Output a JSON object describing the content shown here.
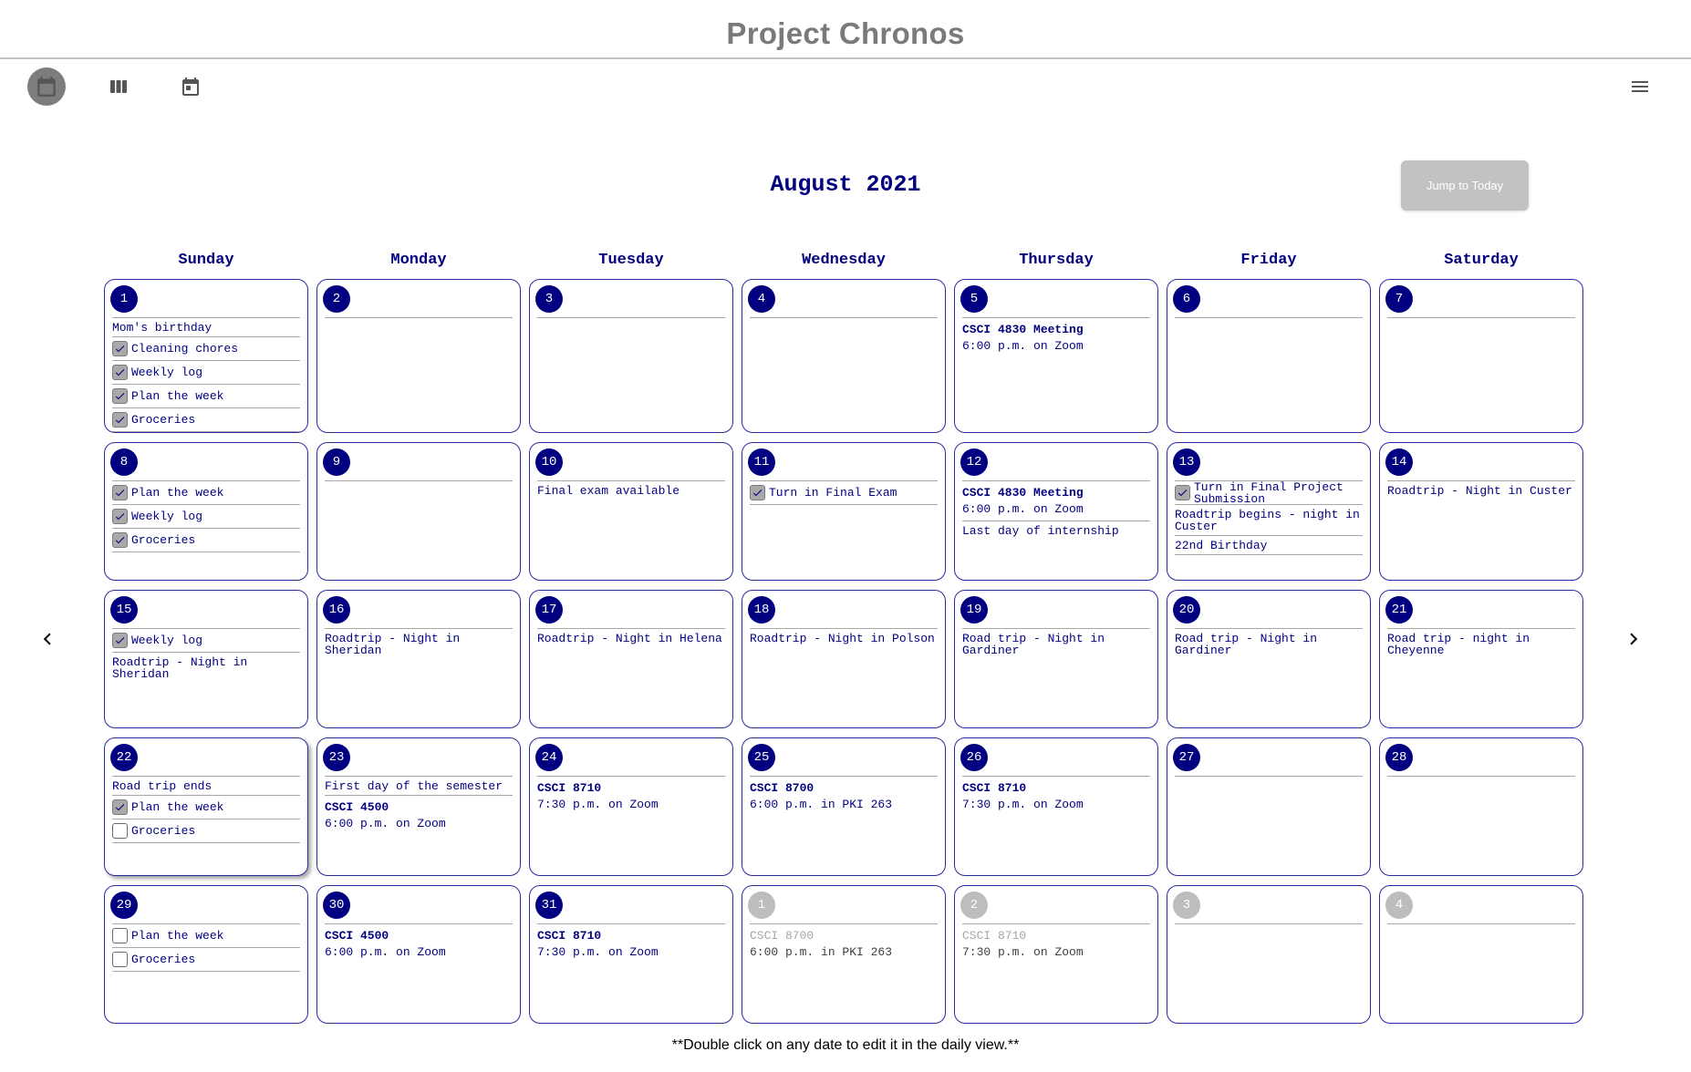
{
  "app": {
    "title": "Project Chronos"
  },
  "toolbar": {
    "icons": [
      "calendar-month-icon",
      "view-week-icon",
      "calendar-day-icon",
      "hamburger-menu-icon"
    ],
    "active_color": "#7d7d7d"
  },
  "calendar": {
    "month_title": "August 2021",
    "jump_today_label": "Jump to Today",
    "weekdays": [
      "Sunday",
      "Monday",
      "Tuesday",
      "Wednesday",
      "Thursday",
      "Friday",
      "Saturday"
    ],
    "accent_color": "#000080",
    "weeks": [
      [
        {
          "day": "1",
          "items": [
            {
              "kind": "note",
              "text": "Mom's birthday",
              "line": true
            },
            {
              "kind": "task",
              "text": "Cleaning chores",
              "checked": true
            },
            {
              "kind": "task",
              "text": "Weekly log",
              "checked": true
            },
            {
              "kind": "task",
              "text": "Plan the week",
              "checked": true
            },
            {
              "kind": "task",
              "text": "Groceries",
              "checked": true
            }
          ]
        },
        {
          "day": "2",
          "items": []
        },
        {
          "day": "3",
          "items": []
        },
        {
          "day": "4",
          "items": []
        },
        {
          "day": "5",
          "items": [
            {
              "kind": "meeting",
              "title": "CSCI 4830 Meeting",
              "detail": "6:00 p.m. on Zoom"
            }
          ]
        },
        {
          "day": "6",
          "items": []
        },
        {
          "day": "7",
          "items": []
        }
      ],
      [
        {
          "day": "8",
          "items": [
            {
              "kind": "task",
              "text": "Plan the week",
              "checked": true
            },
            {
              "kind": "task",
              "text": "Weekly log",
              "checked": true
            },
            {
              "kind": "task",
              "text": "Groceries",
              "checked": true
            }
          ]
        },
        {
          "day": "9",
          "items": []
        },
        {
          "day": "10",
          "items": [
            {
              "kind": "note",
              "text": "Final exam available"
            }
          ]
        },
        {
          "day": "11",
          "items": [
            {
              "kind": "task",
              "text": "Turn in Final Exam",
              "checked": true
            }
          ]
        },
        {
          "day": "12",
          "items": [
            {
              "kind": "meeting",
              "title": "CSCI 4830 Meeting",
              "detail": "6:00 p.m. on Zoom",
              "line": true
            },
            {
              "kind": "note",
              "text": "Last day of internship"
            }
          ]
        },
        {
          "day": "13",
          "items": [
            {
              "kind": "task",
              "text": "Turn in Final Project Submission",
              "checked": true
            },
            {
              "kind": "note",
              "text": "Roadtrip begins - night in Custer",
              "line": true
            },
            {
              "kind": "note",
              "text": "22nd Birthday",
              "line": true
            }
          ]
        },
        {
          "day": "14",
          "items": [
            {
              "kind": "note",
              "text": "Roadtrip - Night in Custer"
            }
          ]
        }
      ],
      [
        {
          "day": "15",
          "items": [
            {
              "kind": "task",
              "text": "Weekly log",
              "checked": true
            },
            {
              "kind": "note",
              "text": "Roadtrip - Night in Sheridan"
            }
          ]
        },
        {
          "day": "16",
          "items": [
            {
              "kind": "note",
              "text": "Roadtrip - Night in Sheridan"
            }
          ]
        },
        {
          "day": "17",
          "items": [
            {
              "kind": "note",
              "text": "Roadtrip - Night in Helena"
            }
          ]
        },
        {
          "day": "18",
          "items": [
            {
              "kind": "note",
              "text": "Roadtrip - Night in Polson"
            }
          ]
        },
        {
          "day": "19",
          "items": [
            {
              "kind": "note",
              "text": "Road trip - Night in Gardiner"
            }
          ]
        },
        {
          "day": "20",
          "items": [
            {
              "kind": "note",
              "text": "Road trip - Night in Gardiner"
            }
          ]
        },
        {
          "day": "21",
          "items": [
            {
              "kind": "note",
              "text": "Road trip - night in Cheyenne"
            }
          ]
        }
      ],
      [
        {
          "day": "22",
          "items": [
            {
              "kind": "note",
              "text": "Road trip ends",
              "line": true
            },
            {
              "kind": "task",
              "text": "Plan the week",
              "checked": true
            },
            {
              "kind": "task",
              "text": "Groceries",
              "checked": false
            }
          ]
        },
        {
          "day": "23",
          "items": [
            {
              "kind": "note",
              "text": "First day of the semester",
              "line": true
            },
            {
              "kind": "meeting",
              "title": "CSCI 4500",
              "detail": "6:00 p.m. on Zoom"
            }
          ]
        },
        {
          "day": "24",
          "items": [
            {
              "kind": "meeting",
              "title": "CSCI 8710",
              "detail": "7:30 p.m. on Zoom"
            }
          ]
        },
        {
          "day": "25",
          "items": [
            {
              "kind": "meeting",
              "title": "CSCI 8700",
              "detail": "6:00 p.m. in PKI 263"
            }
          ]
        },
        {
          "day": "26",
          "items": [
            {
              "kind": "meeting",
              "title": "CSCI 8710",
              "detail": "7:30 p.m. on Zoom"
            }
          ]
        },
        {
          "day": "27",
          "items": []
        },
        {
          "day": "28",
          "items": []
        }
      ],
      [
        {
          "day": "29",
          "items": [
            {
              "kind": "task",
              "text": "Plan the week",
              "checked": false
            },
            {
              "kind": "task",
              "text": "Groceries",
              "checked": false
            }
          ]
        },
        {
          "day": "30",
          "items": [
            {
              "kind": "meeting",
              "title": "CSCI 4500",
              "detail": "6:00 p.m. on Zoom"
            }
          ]
        },
        {
          "day": "31",
          "items": [
            {
              "kind": "meeting",
              "title": "CSCI 8710",
              "detail": "7:30 p.m. on Zoom"
            }
          ]
        },
        {
          "day": "1",
          "other": true,
          "items": [
            {
              "kind": "meeting",
              "title": "CSCI 8700",
              "detail": "6:00 p.m. in PKI 263",
              "dim": true
            }
          ]
        },
        {
          "day": "2",
          "other": true,
          "items": [
            {
              "kind": "meeting",
              "title": "CSCI 8710",
              "detail": "7:30 p.m. on Zoom",
              "dim": true
            }
          ]
        },
        {
          "day": "3",
          "other": true,
          "items": []
        },
        {
          "day": "4",
          "other": true,
          "items": []
        }
      ]
    ]
  },
  "navigation": {
    "prev_icon": "chevron-left-icon",
    "next_icon": "chevron-right-icon"
  },
  "footer": {
    "note": "**Double click on any date to edit it in the daily view.**"
  }
}
